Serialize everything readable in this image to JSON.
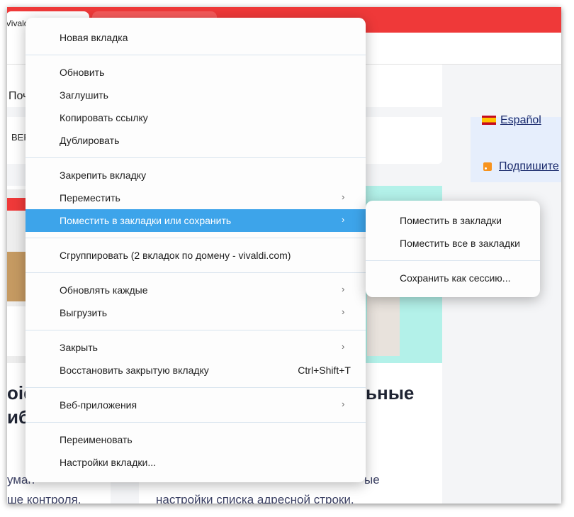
{
  "browser": {
    "active_tab_label": "Vivaldi"
  },
  "page": {
    "left_fragment_1": "Поч",
    "left_fragment_2": "ВЕР",
    "lang_espanol": "Español",
    "subscribe": "Подпишите",
    "heading_left_1": "oid",
    "heading_left_2": "иб",
    "heading_right": "ьные",
    "body_left_1": "уман",
    "body_left_2": "ше контроля,",
    "body_right_1": "ые",
    "body_right_2": "настройки списка адресной строки,"
  },
  "context_menu": {
    "items": [
      {
        "label": "Новая вкладка"
      },
      {
        "label": "Обновить"
      },
      {
        "label": "Заглушить"
      },
      {
        "label": "Копировать ссылку"
      },
      {
        "label": "Дублировать"
      },
      {
        "label": "Закрепить вкладку"
      },
      {
        "label": "Переместить",
        "submenu": true
      },
      {
        "label": "Поместить в закладки или сохранить",
        "submenu": true,
        "highlighted": true
      },
      {
        "label": "Сгруппировать (2 вкладок по домену - vivaldi.com)"
      },
      {
        "label": "Обновлять каждые",
        "submenu": true
      },
      {
        "label": "Выгрузить",
        "submenu": true
      },
      {
        "label": "Закрыть",
        "submenu": true
      },
      {
        "label": "Восстановить закрытую вкладку",
        "shortcut": "Ctrl+Shift+T"
      },
      {
        "label": "Веб-приложения",
        "submenu": true
      },
      {
        "label": "Переименовать"
      },
      {
        "label": "Настройки вкладки..."
      }
    ],
    "submenu_glyph": "›"
  },
  "submenu": {
    "items": [
      {
        "label": "Поместить в закладки"
      },
      {
        "label": "Поместить все в закладки"
      },
      {
        "label": "Сохранить как сессию..."
      }
    ]
  },
  "colors": {
    "tabbar": "#ef3939",
    "highlight": "#3da4ea"
  }
}
